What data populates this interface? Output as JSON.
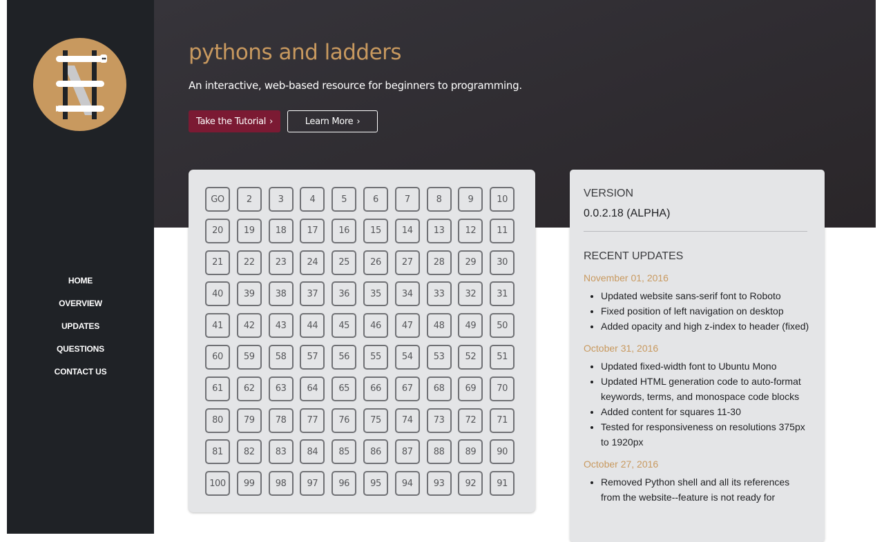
{
  "sidebar": {
    "nav": [
      "HOME",
      "OVERVIEW",
      "UPDATES",
      "QUESTIONS",
      "CONTACT US"
    ]
  },
  "hero": {
    "title": "pythons and ladders",
    "subtitle": "An interactive, web-based resource for beginners to programming.",
    "primary_button": "Take the Tutorial",
    "secondary_button": "Learn More",
    "chevron": "›"
  },
  "board": {
    "cells": [
      "GO",
      "2",
      "3",
      "4",
      "5",
      "6",
      "7",
      "8",
      "9",
      "10",
      "20",
      "19",
      "18",
      "17",
      "16",
      "15",
      "14",
      "13",
      "12",
      "11",
      "21",
      "22",
      "23",
      "24",
      "25",
      "26",
      "27",
      "28",
      "29",
      "30",
      "40",
      "39",
      "38",
      "37",
      "36",
      "35",
      "34",
      "33",
      "32",
      "31",
      "41",
      "42",
      "43",
      "44",
      "45",
      "46",
      "47",
      "48",
      "49",
      "50",
      "60",
      "59",
      "58",
      "57",
      "56",
      "55",
      "54",
      "53",
      "52",
      "51",
      "61",
      "62",
      "63",
      "64",
      "65",
      "66",
      "67",
      "68",
      "69",
      "70",
      "80",
      "79",
      "78",
      "77",
      "76",
      "75",
      "74",
      "73",
      "72",
      "71",
      "81",
      "82",
      "83",
      "84",
      "85",
      "86",
      "87",
      "88",
      "89",
      "90",
      "100",
      "99",
      "98",
      "97",
      "96",
      "95",
      "94",
      "93",
      "92",
      "91"
    ]
  },
  "panel": {
    "version_heading": "VERSION",
    "version_value": "0.0.2.18 (ALPHA)",
    "updates_heading": "RECENT UPDATES",
    "updates": [
      {
        "date": "November 01, 2016",
        "items": [
          "Updated website sans-serif font to Roboto",
          "Fixed position of left navigation on desktop",
          "Added opacity and high z-index to header (fixed)"
        ]
      },
      {
        "date": "October 31, 2016",
        "items": [
          "Updated fixed-width font to Ubuntu Mono",
          "Updated HTML generation code to auto-format keywords, terms, and monospace code blocks",
          "Added content for squares 11-30",
          "Tested for responsiveness on resolutions 375px to 1920px"
        ]
      },
      {
        "date": "October 27, 2016",
        "items": [
          "Removed Python shell and all its references from the website--feature is not ready for"
        ]
      }
    ]
  },
  "colors": {
    "accent": "#c8995f",
    "primary_button": "#7b1a33",
    "sidebar": "#1f2226",
    "logo_bg": "#c8995f"
  },
  "icons": {
    "logo": "ladder-python-logo"
  }
}
